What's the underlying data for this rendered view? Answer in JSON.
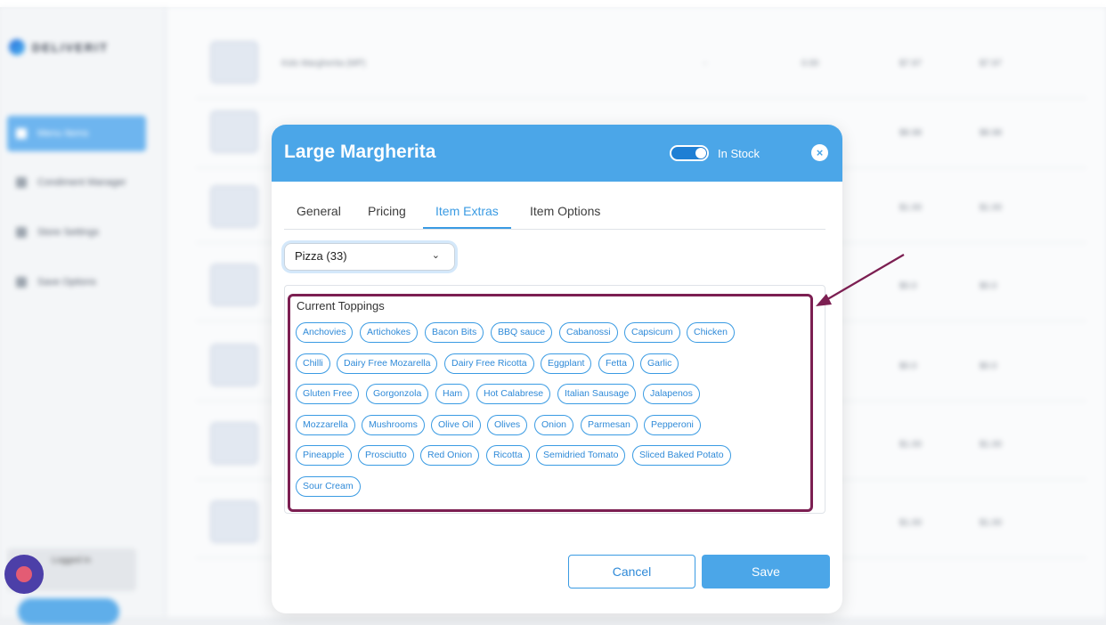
{
  "app": {
    "logo_text": "DELIVERIT"
  },
  "sidebar": {
    "items": [
      {
        "label": "Menu Items",
        "active": true
      },
      {
        "label": "Condiment Manager",
        "active": false
      },
      {
        "label": "Store Settings",
        "active": false
      },
      {
        "label": "Save Options",
        "active": false
      }
    ],
    "user_label": "Logged in"
  },
  "background_rows": [
    {
      "name": "Kids Margherita (MP)",
      "cols": [
        "-",
        "0.00",
        "$7.97",
        "$7.97"
      ]
    },
    {
      "cols": [
        "$8.98",
        "$8.98"
      ]
    },
    {
      "cols": [
        "$1.00",
        "$1.00"
      ]
    },
    {
      "cols": [
        "$0.0",
        "$0.0"
      ]
    },
    {
      "cols": [
        "$0.0",
        "$0.0"
      ]
    },
    {
      "cols": [
        "$1.00",
        "$1.00"
      ]
    },
    {
      "cols": [
        "$1.00",
        "$1.00"
      ]
    }
  ],
  "modal": {
    "title": "Large Margherita",
    "stock_toggle": {
      "label": "In Stock",
      "on": true
    },
    "close_glyph": "×",
    "tabs": [
      {
        "label": "General",
        "active": false
      },
      {
        "label": "Pricing",
        "active": false
      },
      {
        "label": "Item Extras",
        "active": true
      },
      {
        "label": "Item Options",
        "active": false
      }
    ],
    "group_select": {
      "value": "Pizza (33)",
      "chevron": "⌄"
    },
    "toppings": {
      "title": "Current Toppings",
      "rows": [
        [
          "Anchovies",
          "Artichokes",
          "Bacon Bits",
          "BBQ sauce",
          "Cabanossi",
          "Capsicum",
          "Chicken"
        ],
        [
          "Chilli",
          "Dairy Free Mozarella",
          "Dairy Free Ricotta",
          "Eggplant",
          "Fetta",
          "Garlic"
        ],
        [
          "Gluten Free",
          "Gorgonzola",
          "Ham",
          "Hot Calabrese",
          "Italian Sausage",
          "Jalapenos"
        ],
        [
          "Mozzarella",
          "Mushrooms",
          "Olive Oil",
          "Olives",
          "Onion",
          "Parmesan",
          "Pepperoni"
        ],
        [
          "Pineapple",
          "Prosciutto",
          "Red Onion",
          "Ricotta",
          "Semidried Tomato",
          "Sliced Baked Potato"
        ],
        [
          "Sour Cream"
        ]
      ]
    },
    "buttons": {
      "cancel": "Cancel",
      "save": "Save"
    }
  },
  "colors": {
    "accent": "#4ba6e8",
    "highlight_box": "#7c1f52",
    "chip_border": "#3a9be3"
  }
}
